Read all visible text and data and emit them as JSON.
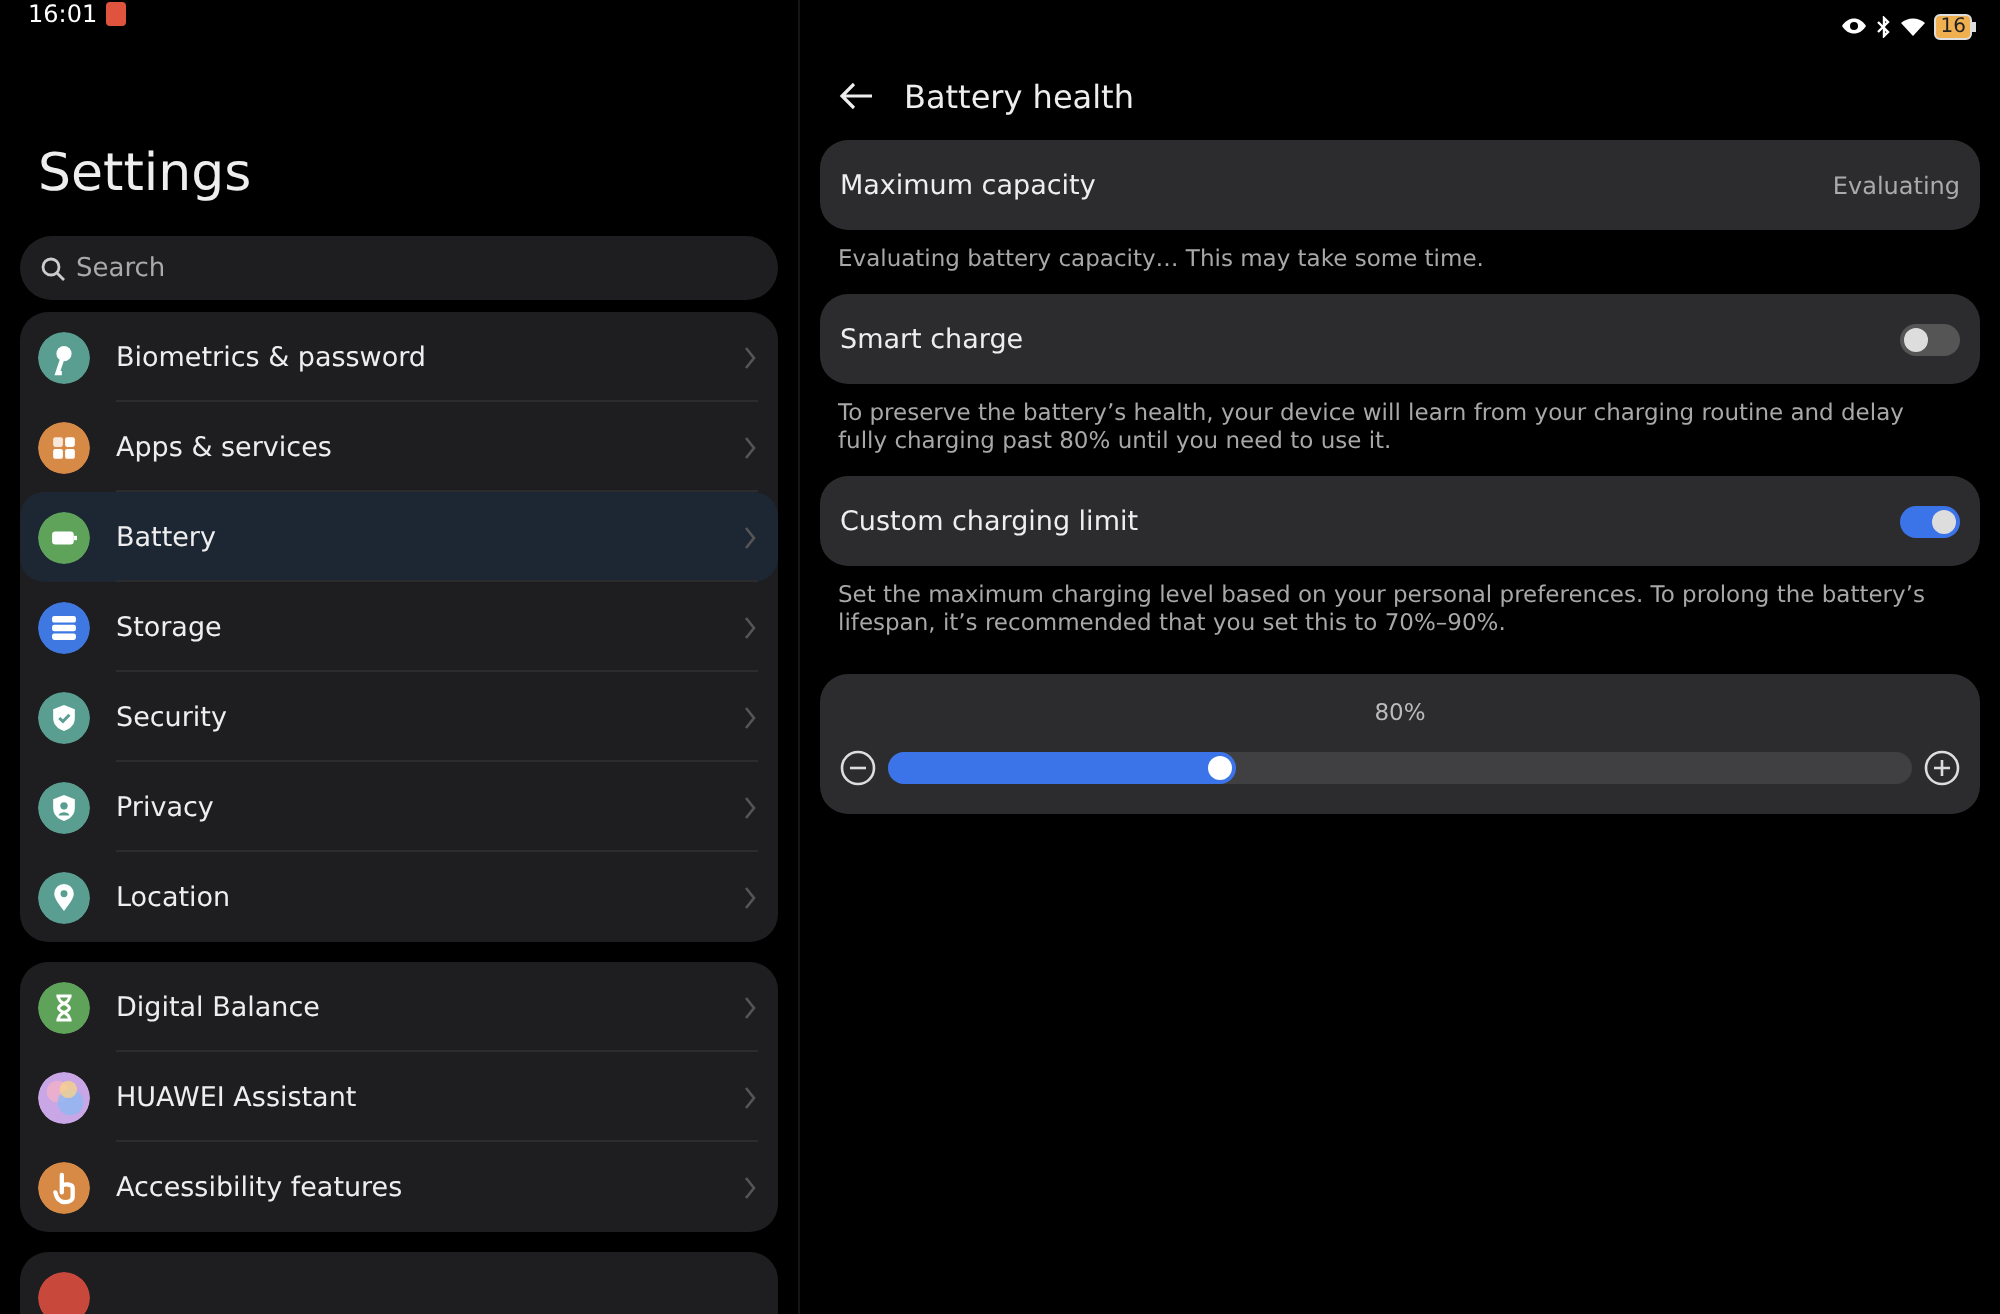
{
  "status_bar": {
    "time": "16:01",
    "battery": "16"
  },
  "sidebar": {
    "title": "Settings",
    "search": {
      "placeholder": "Search"
    },
    "groups": [
      {
        "items": [
          {
            "label": "Biometrics & password",
            "color": "#5a9e92",
            "selected": false
          },
          {
            "label": "Apps & services",
            "color": "#d68a45",
            "selected": false
          },
          {
            "label": "Battery",
            "color": "#5fa35a",
            "selected": true
          },
          {
            "label": "Storage",
            "color": "#3f78e0",
            "selected": false
          },
          {
            "label": "Security",
            "color": "#5a9e92",
            "selected": false
          },
          {
            "label": "Privacy",
            "color": "#5a9e92",
            "selected": false
          },
          {
            "label": "Location",
            "color": "#5a9e92",
            "selected": false
          }
        ]
      },
      {
        "items": [
          {
            "label": "Digital Balance",
            "color": "#5fa35a",
            "selected": false
          },
          {
            "label": "HUAWEI Assistant",
            "color": "#c9a6e6",
            "selected": false
          },
          {
            "label": "Accessibility features",
            "color": "#d68a45",
            "selected": false
          }
        ]
      },
      {
        "items": [
          {
            "color": "#c9483c",
            "selected": false
          }
        ]
      }
    ]
  },
  "page": {
    "title": "Battery health",
    "cards": [
      {
        "kind": "value",
        "label": "Maximum capacity",
        "value": "Evaluating",
        "note": "Evaluating battery capacity… This may take some time."
      },
      {
        "kind": "toggle",
        "label": "Smart charge",
        "on": false,
        "note": "To preserve the battery’s health, your device will learn from your charging routine and delay fully charging past 80% until you need to use it."
      },
      {
        "kind": "toggle",
        "label": "Custom charging limit",
        "on": true,
        "note": "Set the maximum charging level based on your personal preferences. To prolong the battery’s lifespan, it’s recommended that you set this to 70%–90%."
      },
      {
        "kind": "slider",
        "reading": "80%",
        "level": 0.34
      }
    ]
  }
}
